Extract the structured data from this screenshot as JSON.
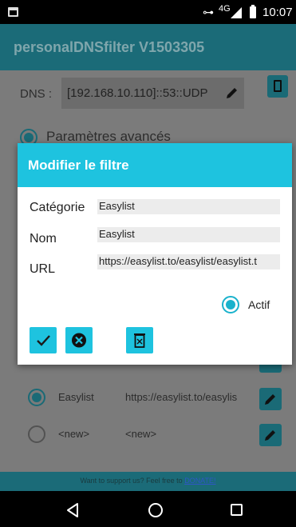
{
  "status_bar": {
    "network": "4G",
    "time": "10:07",
    "icons": [
      "app-notification-icon",
      "vpn-key-icon",
      "signal-icon",
      "battery-icon"
    ]
  },
  "app": {
    "title": "personalDNSfilter V1503305",
    "dns_label": "DNS :",
    "dns_value": "[192.168.10.110]::53::UDP",
    "advanced_label": "Paramètres avancés"
  },
  "filter_list": [
    {
      "name": "Easylist",
      "url": "https://easylist.to/easylis",
      "active": true
    },
    {
      "name": "<new>",
      "url": "<new>",
      "active": false
    }
  ],
  "donate": {
    "text": "Want to support us? Feel free to ",
    "link": "DONATE!"
  },
  "dialog": {
    "title": "Modifier le filtre",
    "category_label": "Catégorie",
    "category_value": "Easylist",
    "name_label": "Nom",
    "name_value": "Easylist",
    "url_label": "URL",
    "url_value": "https://easylist.to/easylist/easylist.t",
    "active_label": "Actif",
    "active": true
  },
  "colors": {
    "accent": "#1ec3df",
    "app_bar_dimmed": "#1b6b78",
    "dim_background": "#7b7b7b"
  },
  "navigation": [
    "back-icon",
    "home-icon",
    "recents-icon"
  ]
}
